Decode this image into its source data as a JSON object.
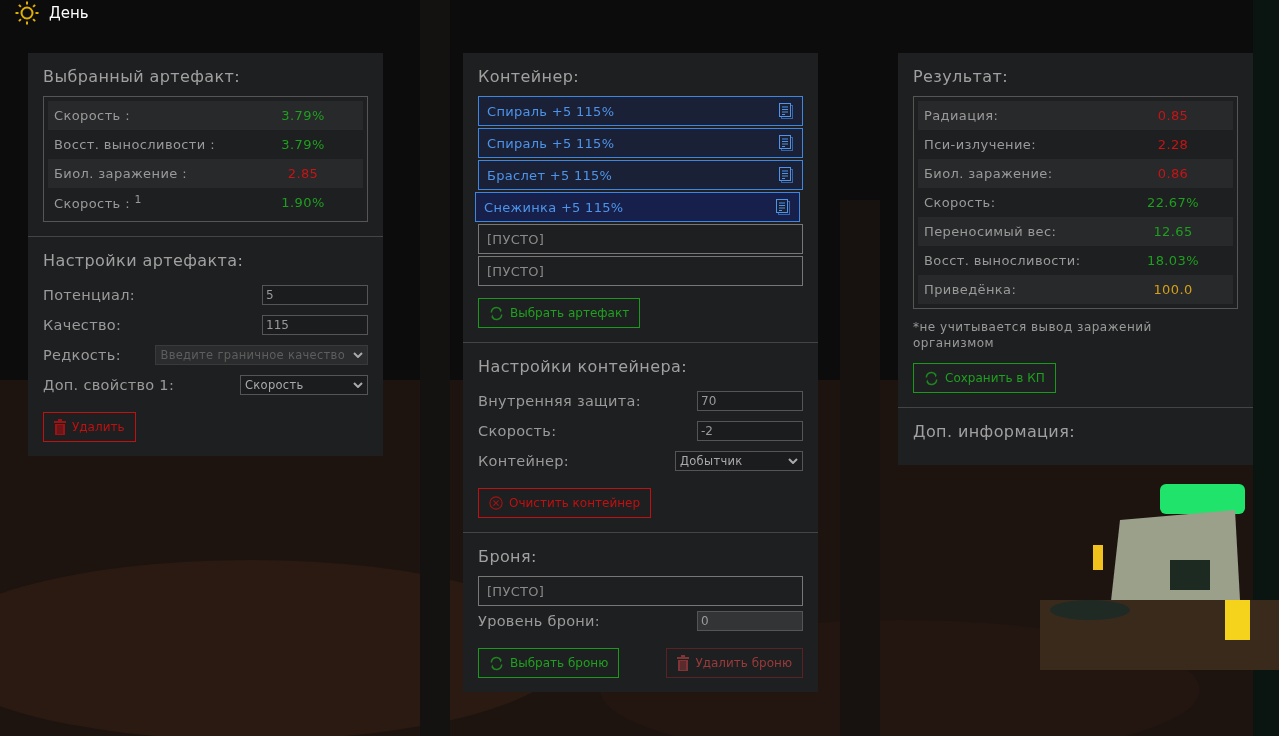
{
  "header": {
    "label": "День"
  },
  "artifact_panel": {
    "title": "Выбранный артефакт:",
    "stats": [
      {
        "label": "Скорость :",
        "value": "3.79%",
        "color": "#1f9f1f"
      },
      {
        "label": "Восст. выносливости :",
        "value": "3.79%",
        "color": "#1f9f1f"
      },
      {
        "label": "Биол. заражение :",
        "value": "2.85",
        "color": "#c81414"
      },
      {
        "label": "Скорость : $^{1}$",
        "value": "1.90%",
        "color": "#1f9f1f"
      }
    ],
    "settings_title": "Настройки артефакта:",
    "fields": [
      {
        "kind": "input",
        "label": "Потенциал:",
        "value": "5",
        "disabled": false
      },
      {
        "kind": "input",
        "label": "Качество:",
        "value": "115",
        "disabled": false
      },
      {
        "kind": "select",
        "label": "Редкость:",
        "value": "Введите граничное качество",
        "disabled": true
      },
      {
        "kind": "select",
        "label": "Доп. свойство 1:",
        "value": "Скорость",
        "disabled": false
      }
    ],
    "buttons": [
      {
        "kind": "delete",
        "label": "Удалить",
        "disabled": false
      }
    ]
  },
  "container_panel": {
    "title": "Контейнер:",
    "slots": [
      {
        "kind": "artifact",
        "label": "Спираль +5 115%",
        "selected": false
      },
      {
        "kind": "artifact",
        "label": "Спираль +5 115%",
        "selected": false
      },
      {
        "kind": "artifact",
        "label": "Браслет +5 115%",
        "selected": false
      },
      {
        "kind": "artifact",
        "label": "Снежинка +5 115%",
        "selected": true
      },
      {
        "kind": "empty",
        "label": "[ПУСТО]",
        "selected": false
      },
      {
        "kind": "empty",
        "label": "[ПУСТО]",
        "selected": false
      }
    ],
    "slot_buttons": [
      {
        "kind": "select",
        "label": "Выбрать артефакт",
        "disabled": false
      }
    ],
    "settings_title": "Настройки контейнера:",
    "fields": [
      {
        "kind": "input",
        "label": "Внутренняя защита:",
        "value": "70",
        "disabled": false
      },
      {
        "kind": "input",
        "label": "Скорость:",
        "value": "-2",
        "disabled": false
      },
      {
        "kind": "select",
        "label": "Контейнер:",
        "value": "Добытчик",
        "disabled": false
      }
    ],
    "settings_buttons": [
      {
        "kind": "clear",
        "label": "Очистить контейнер",
        "disabled": false
      }
    ],
    "armor_title": "Броня:",
    "armor_slot": {
      "kind": "empty",
      "label": "[ПУСТО]",
      "selected": false
    },
    "armor_fields": [
      {
        "kind": "input",
        "label": "Уровень брони:",
        "value": "0",
        "disabled": true
      }
    ],
    "armor_buttons": [
      {
        "kind": "select",
        "label": "Выбрать броню",
        "disabled": false
      },
      {
        "kind": "delete",
        "label": "Удалить броню",
        "disabled": true
      }
    ]
  },
  "result_panel": {
    "title": "Результат:",
    "stats": [
      {
        "label": "Радиация:",
        "value": "0.85",
        "color": "#c81414"
      },
      {
        "label": "Пси-излучение:",
        "value": "2.28",
        "color": "#c81414"
      },
      {
        "label": "Биол. заражение:",
        "value": "0.86",
        "color": "#c81414"
      },
      {
        "label": "Скорость:",
        "value": "22.67%",
        "color": "#1f9f1f"
      },
      {
        "label": "Переносимый вес:",
        "value": "12.65",
        "color": "#1f9f1f"
      },
      {
        "label": "Восст. выносливости:",
        "value": "18.03%",
        "color": "#1f9f1f"
      },
      {
        "label": "Приведёнка:",
        "value": "100.0",
        "color": "#d4a017"
      }
    ],
    "note": "*не учитывается вывод заражений организмом",
    "buttons": [
      {
        "kind": "select",
        "label": "Сохранить в КП",
        "disabled": false
      }
    ],
    "info_title": "Доп. информация:"
  }
}
